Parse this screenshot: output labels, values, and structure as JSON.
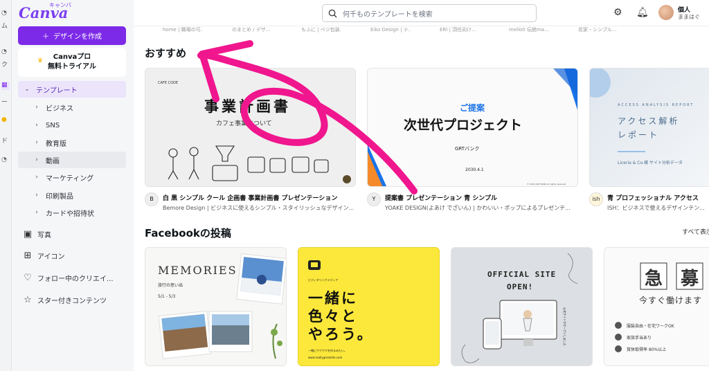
{
  "app": {
    "logo": "Canva",
    "logo_sub": "キャンバ"
  },
  "sidebar": {
    "create_label": "デザインを作成",
    "trial_line1": "Canvaプロ",
    "trial_line2": "無料トライアル",
    "templates_label": "テンプレート",
    "sub_items": [
      "ビジネス",
      "SNS",
      "教育版",
      "動画",
      "マーケティング",
      "印刷製品",
      "カードや招待状"
    ],
    "items": [
      "写真",
      "アイコン",
      "フォロー中のクリエイ...",
      "スター付きコンテンツ"
    ],
    "rail_labels": [
      "ム",
      "ク",
      "ー",
      "ド"
    ]
  },
  "topbar": {
    "search_placeholder": "何千ものテンプレートを検索",
    "user_name": "個人",
    "user_sub": "ままはぐ"
  },
  "strip_labels": [
    "home | 職場の可...",
    "のまとめ / デザ...",
    "もふに | ベジ包装...",
    "Eiko Design | テ...",
    "ERI | 頂任向け...",
    "mello0 伝統ma...",
    "花家・シンプル..."
  ],
  "recommend": {
    "title": "おすすめ",
    "cards": [
      {
        "title": "白 黒 シンプル クール 企画書 事業計画書 プレゼンテーション",
        "author": "Bemore Design | ビジネスに使えるシンプル・スタイリッシュなデザイン...",
        "avatar": "B",
        "thumb_brand": "CAFE CODE",
        "thumb_title": "事業計画書",
        "thumb_sub": "カフェ事業について"
      },
      {
        "title": "提案書 プレゼンテーション 青 シンプル",
        "author": "YOAKE DESIGN(よあけ でざいん) | かわいい・ポップによるプレゼンテ...",
        "avatar": "Y",
        "thumb_kicker": "ご提案",
        "thumb_title": "次世代プロジェクト",
        "thumb_brand": "GRTバンク",
        "thumb_date": "2030.4.1",
        "thumb_copy": "© 2030 GRT BANK All rights reserved."
      },
      {
        "title": "青 プロフェッショナル アクセス",
        "author": "ISH：ビジネスで使えるデザインテン...",
        "avatar": "ish",
        "thumb_kicker": "ACCESS ANALYSIS REPORT",
        "thumb_title1": "アクセス解析",
        "thumb_title2": "レポート",
        "thumb_sub": "Liceria & Co.様 サイト分析データ"
      }
    ]
  },
  "facebook": {
    "title": "Facebookの投稿",
    "see_all": "すべて表示",
    "cards": [
      {
        "t1": "MEMORIES",
        "t2": "旅行の思い出",
        "t3": "5/1 - 5/3"
      },
      {
        "t1": "ビディタリンクメディア",
        "t2": "一緒に",
        "t3": "色々と",
        "t4": "やろう。",
        "t5": "一緒にワクワクを作るみたい。",
        "t6": "www.reallygreatsite.com"
      },
      {
        "t1": "OFFICIAL SITE",
        "t2": "OPEN!",
        "t3": "公式サイトがオープンしました"
      },
      {
        "t1": "急",
        "t2": "募",
        "t3": "今すぐ働けます",
        "r1": "服装自由・在宅ワークOK",
        "r2": "家族手当あり",
        "r3": "賞休取得率 80%以上"
      }
    ]
  },
  "colors": {
    "brand": "#7d2ae8",
    "annotation": "#f0168e"
  }
}
